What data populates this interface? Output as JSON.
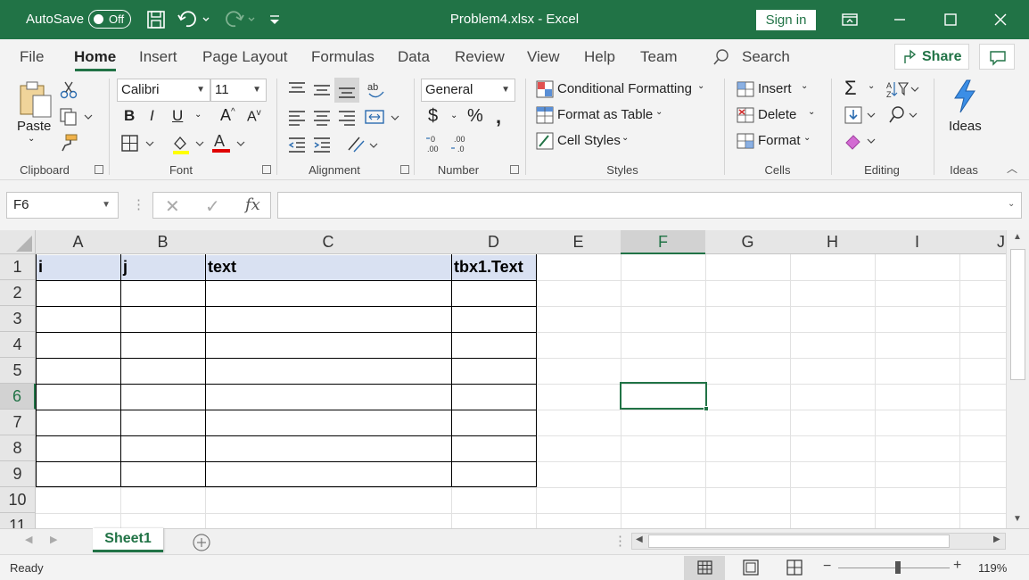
{
  "titlebar": {
    "autosave_label": "AutoSave",
    "autosave_state": "Off",
    "title": "Problem4.xlsx  -  Excel",
    "signin_label": "Sign in",
    "bg_color": "#217346"
  },
  "tabs": [
    {
      "label": "File"
    },
    {
      "label": "Home"
    },
    {
      "label": "Insert"
    },
    {
      "label": "Page Layout"
    },
    {
      "label": "Formulas"
    },
    {
      "label": "Data"
    },
    {
      "label": "Review"
    },
    {
      "label": "View"
    },
    {
      "label": "Help"
    },
    {
      "label": "Team"
    }
  ],
  "search_label": "Search",
  "share_label": "Share",
  "ribbon": {
    "clipboard": {
      "paste_label": "Paste",
      "group_label": "Clipboard"
    },
    "font": {
      "font_name": "Calibri",
      "font_size": "11",
      "group_label": "Font"
    },
    "alignment": {
      "group_label": "Alignment"
    },
    "number": {
      "format": "General",
      "group_label": "Number"
    },
    "styles": {
      "conditional_formatting": "Conditional Formatting",
      "format_as_table": "Format as Table",
      "cell_styles": "Cell Styles",
      "group_label": "Styles"
    },
    "cells": {
      "insert": "Insert",
      "delete": "Delete",
      "format": "Format",
      "group_label": "Cells"
    },
    "editing": {
      "group_label": "Editing"
    },
    "ideas": {
      "label": "Ideas",
      "group_label": "Ideas"
    }
  },
  "formula_bar": {
    "name_box": "F6",
    "fx_label": "fx",
    "formula": ""
  },
  "columns": [
    "A",
    "B",
    "C",
    "D",
    "E",
    "F",
    "G",
    "H",
    "I",
    "J"
  ],
  "rows": [
    "1",
    "2",
    "3",
    "4",
    "5",
    "6",
    "7",
    "8",
    "9",
    "10",
    "11"
  ],
  "cells": {
    "A1": "i",
    "B1": "j",
    "C1": "text",
    "D1": "tbx1.Text"
  },
  "selected_cell": "F6",
  "sheet_tab": "Sheet1",
  "status": {
    "ready": "Ready",
    "zoom": "119%"
  },
  "colors": {
    "accent": "#217346",
    "header_fill": "#d9e1f2"
  }
}
